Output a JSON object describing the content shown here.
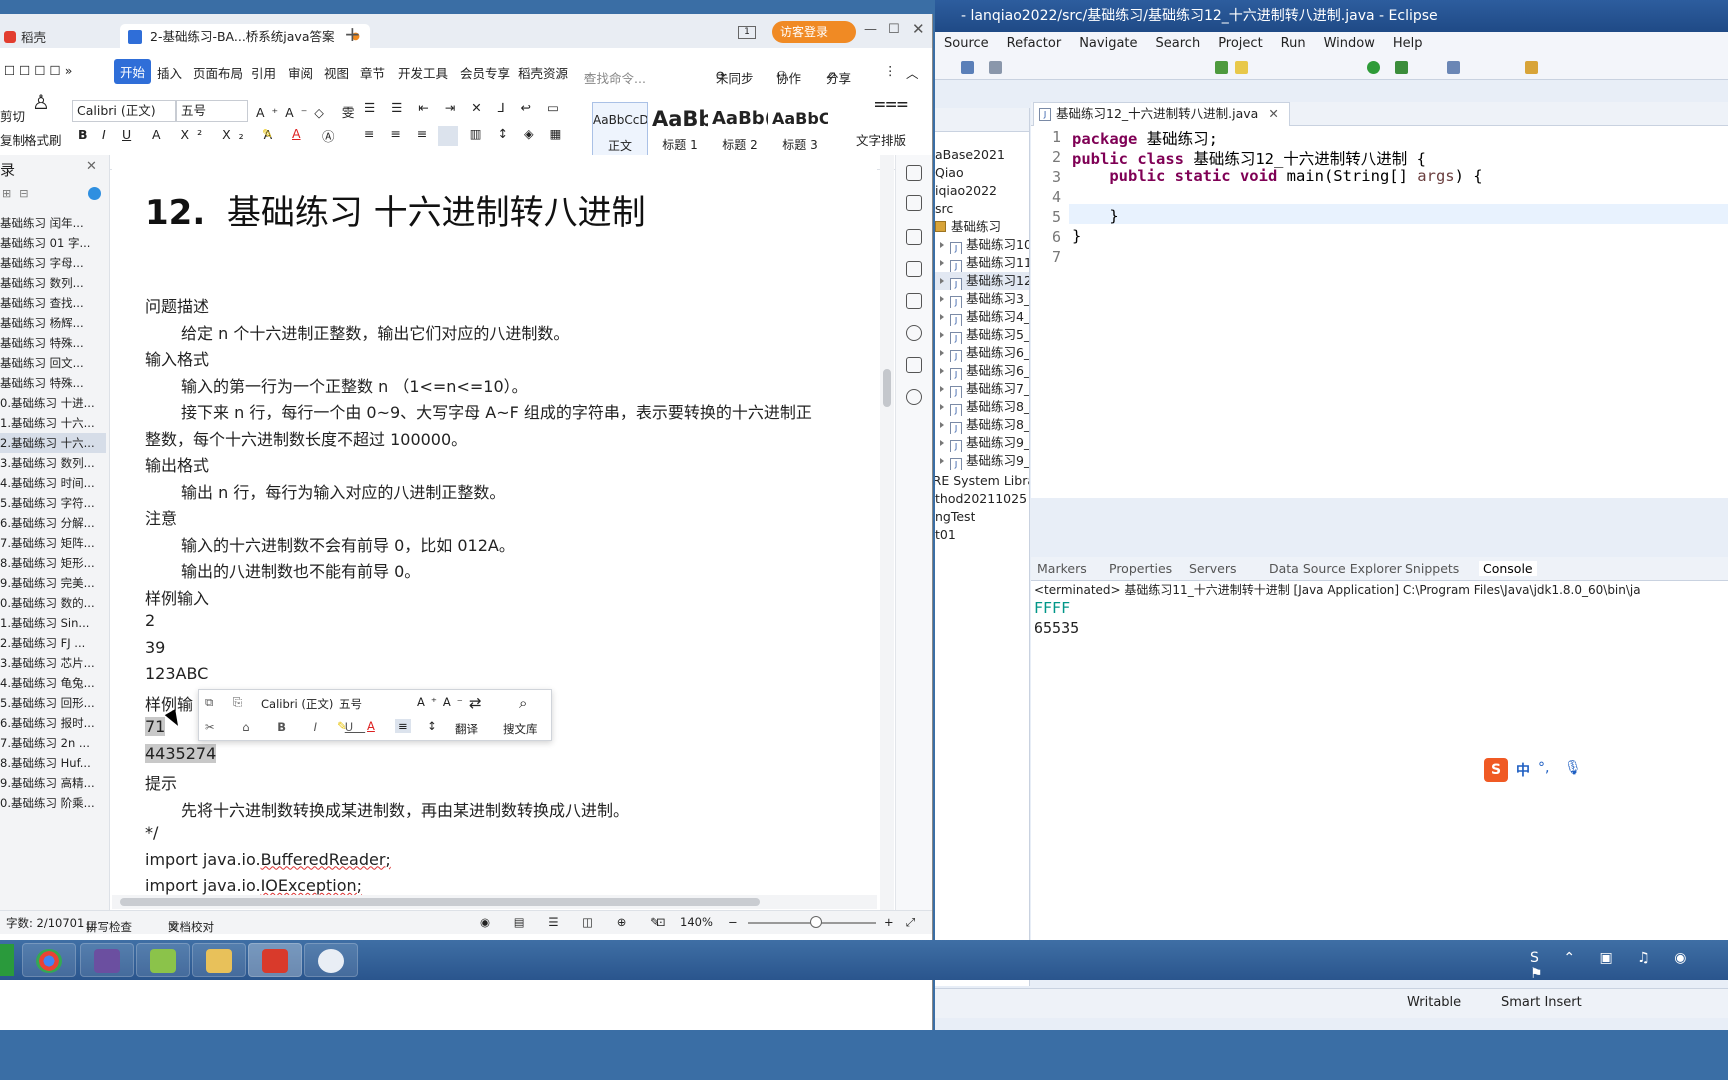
{
  "eclipse": {
    "title": "- lanqiao2022/src/基础练习/基础练习12_十六进制转八进制.java - Eclipse",
    "menu": [
      "Source",
      "Refactor",
      "Navigate",
      "Search",
      "Project",
      "Run",
      "Window",
      "Help"
    ],
    "package_explorer": {
      "rows": [
        "aBase2021",
        "Qiao",
        "iqiao2022",
        "src",
        "基础练习",
        "基础练习10",
        "基础练习11",
        "基础练习12",
        "基础练习3_",
        "基础练习4_",
        "基础练习5_",
        "基础练习6_",
        "基础练习6_",
        "基础练习7_",
        "基础练习8_",
        "基础练习8_",
        "基础练习9_",
        "基础练习9_",
        "JRE System Librar",
        "thod20211025",
        "ngTest",
        "t01"
      ]
    },
    "editor_tab": "基础练习12_十六进制转八进制.java",
    "code_lines": [
      {
        "num": "1",
        "parts": [
          {
            "t": "package",
            "k": "kw"
          },
          {
            "t": " 基础练习;",
            "k": ""
          }
        ]
      },
      {
        "num": "2",
        "parts": [
          {
            "t": "public class",
            "k": "kw"
          },
          {
            "t": " 基础练习12_十六进制转八进制 {",
            "k": ""
          }
        ]
      },
      {
        "num": "3",
        "parts": [
          {
            "t": "    public static void",
            "k": "kw"
          },
          {
            "t": " main(String[] ",
            "k": ""
          },
          {
            "t": "args",
            "k": "var"
          },
          {
            "t": ") {",
            "k": ""
          }
        ]
      },
      {
        "num": "4",
        "parts": [
          {
            "t": "",
            "k": ""
          }
        ]
      },
      {
        "num": "5",
        "parts": [
          {
            "t": "    }",
            "k": ""
          }
        ]
      },
      {
        "num": "6",
        "parts": [
          {
            "t": "}",
            "k": ""
          }
        ]
      },
      {
        "num": "7",
        "parts": [
          {
            "t": "",
            "k": ""
          }
        ]
      }
    ],
    "console_tabs": [
      "Markers",
      "Properties",
      "Servers",
      "Data Source Explorer",
      "Snippets",
      "Console"
    ],
    "console_header": "<terminated> 基础练习11_十六进制转十进制 [Java Application] C:\\Program Files\\Java\\jdk1.8.0_60\\bin\\ja",
    "console_input": "FFFF",
    "console_output": "65535",
    "status": {
      "writable": "Writable",
      "insert": "Smart Insert"
    },
    "colors": {
      "keyword": "#7f0055",
      "input": "#009688",
      "current_line": "#e8f2fe"
    }
  },
  "wps": {
    "home_tab": "稻壳",
    "doc_tab": "2-基础练习-BA...桥系统java答案",
    "visitor_login": "访客登录",
    "menu": [
      "开始",
      "插入",
      "页面布局",
      "引用",
      "审阅",
      "视图",
      "章节",
      "开发工具",
      "会员专享",
      "稻壳资源"
    ],
    "search_placeholder": "查找命令...",
    "menu_right": [
      "未同步",
      "协作",
      "分享"
    ],
    "ribbon": {
      "cut": "剪切",
      "copy_format": "复制",
      "format_painter": "格式刷",
      "font": "Calibri (正文)",
      "size": "五号",
      "styles": [
        {
          "preview": "AaBbCcDd",
          "label": "正文"
        },
        {
          "preview": "AaBb",
          "label": "标题 1"
        },
        {
          "preview": "AaBb(",
          "label": "标题 2"
        },
        {
          "preview": "AaBbC",
          "label": "标题 3"
        }
      ],
      "text_layout": "文字排版"
    },
    "nav_title": "录",
    "nav_items": [
      "基础练习 闰年...",
      "基础练习 01 字...",
      "基础练习 字母...",
      "基础练习 数列...",
      "基础练习 查找...",
      "基础练习 杨辉...",
      "基础练习 特殊...",
      "基础练习 回文...",
      "基础练习 特殊...",
      "0.基础练习 十进...",
      "1.基础练习 十六...",
      "2.基础练习 十六...",
      "3.基础练习 数列...",
      "4.基础练习 时间...",
      "5.基础练习 字符...",
      "6.基础练习 分解...",
      "7.基础练习 矩阵...",
      "8.基础练习 矩形...",
      "9.基础练习 完美...",
      "0.基础练习 数的...",
      "1.基础练习 Sin...",
      "2.基础练习 FJ ...",
      "3.基础练习 芯片...",
      "4.基础练习 龟兔...",
      "5.基础练习 回形...",
      "6.基础练习 报时...",
      "7.基础练习 2n ...",
      "8.基础练习 Huf...",
      "9.基础练习 高精...",
      "0.基础练习 阶乘..."
    ],
    "doc": {
      "title_num": "12.",
      "title_text": "基础练习  十六进制转八进制",
      "lines": [
        {
          "text": "问题描述",
          "indent": false
        },
        {
          "text": "给定 n 个十六进制正整数，输出它们对应的八进制数。",
          "indent": true
        },
        {
          "text": "输入格式",
          "indent": false
        },
        {
          "text": "输入的第一行为一个正整数 n （1<=n<=10）。",
          "indent": true
        },
        {
          "text": "接下来 n 行，每行一个由 0~9、大写字母 A~F 组成的字符串，表示要转换的十六进制正",
          "indent": true
        },
        {
          "text": "整数，每个十六进制数长度不超过 100000。",
          "indent": false
        },
        {
          "text": "输出格式",
          "indent": false
        },
        {
          "text": "输出 n 行，每行为输入对应的八进制正整数。",
          "indent": true
        },
        {
          "text": "注意",
          "indent": false
        },
        {
          "text": "输入的十六进制数不会有前导 0，比如 012A。",
          "indent": true
        },
        {
          "text": "输出的八进制数也不能有前导 0。",
          "indent": true
        },
        {
          "text": "样例输入",
          "indent": false
        },
        {
          "text": "2",
          "indent": false
        },
        {
          "text": "39",
          "indent": false
        },
        {
          "text": "123ABC",
          "indent": false
        },
        {
          "text": "样例输",
          "indent": false
        },
        {
          "text": "71",
          "indent": false
        },
        {
          "text": "4435274",
          "indent": false
        },
        {
          "text": "提示",
          "indent": false
        },
        {
          "text": "先将十六进制数转换成某进制数，再由某进制数转换成八进制。",
          "indent": true
        },
        {
          "text": "*/",
          "indent": false
        },
        {
          "text": "import java.io.BufferedReader;",
          "indent": false
        },
        {
          "text": "import java.io.IOException;",
          "indent": false
        }
      ]
    },
    "mini_toolbar": {
      "font": "Calibri (正文)",
      "size": "五号",
      "translate": "翻译",
      "search_lib": "搜文库"
    },
    "status": {
      "word_count": "字数: 2/10701",
      "spell_check": "拼写检查",
      "doc_check": "文档校对",
      "zoom": "140%"
    }
  },
  "ime": {
    "label": "中"
  }
}
